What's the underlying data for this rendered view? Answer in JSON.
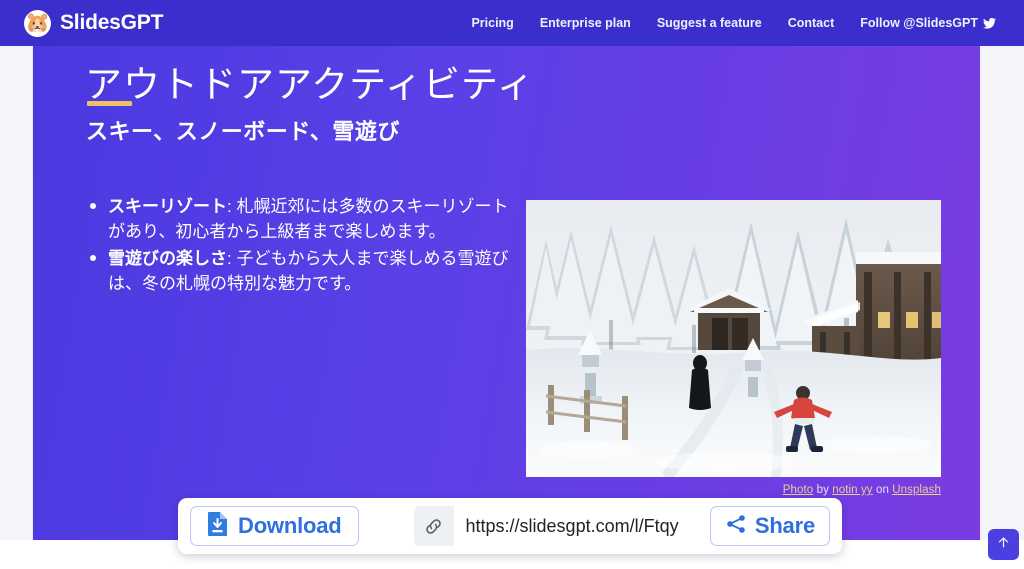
{
  "header": {
    "brand": {
      "logo_icon": "hamster-logo-icon",
      "name": "SlidesGPT"
    },
    "nav_links": [
      {
        "label": "Pricing",
        "name": "nav-link-pricing"
      },
      {
        "label": "Enterprise plan",
        "name": "nav-link-enterprise-plan"
      },
      {
        "label": "Suggest a feature",
        "name": "nav-link-suggest-a-feature"
      },
      {
        "label": "Contact",
        "name": "nav-link-contact"
      }
    ],
    "social": {
      "label": "Follow @SlidesGPT",
      "icon": "twitter-bird-icon"
    },
    "bar_color": "#3a2fcc"
  },
  "slide": {
    "title": "アウトドアアクティビティ",
    "subtitle": "スキー、スノーボード、雪遊び",
    "accent_rule_color": "#f0c064",
    "background_gradient_from": "#4a39e0",
    "background_gradient_to": "#7a3ce2",
    "bullets": [
      {
        "lead": "スキーリゾート",
        "body": ": 札幌近郊には多数のスキーリゾートがあり、初心者から上級者まで楽しめます。"
      },
      {
        "lead": "雪遊びの楽しさ",
        "body": ": 子どもから大人まで楽しめる雪遊びは、冬の札幌の特別な魅力です。"
      }
    ],
    "photo": {
      "alt": "snow-covered-japanese-temple-scene",
      "credit": {
        "photo_word": "Photo",
        "by_word": " by ",
        "author": "notin yy",
        "on_word": " on ",
        "source": "Unsplash"
      }
    }
  },
  "actions": {
    "download": {
      "label": "Download",
      "icon": "file-download-icon",
      "color": "#2f6fe0"
    },
    "link": {
      "icon": "link-chain-icon",
      "url": "https://slidesgpt.com/l/Ftqy"
    },
    "share": {
      "label": "Share",
      "icon": "share-nodes-icon",
      "color": "#2f6fe0"
    }
  },
  "scroll_top": {
    "icon": "arrow-up-icon",
    "color": "#4a3fe0"
  }
}
